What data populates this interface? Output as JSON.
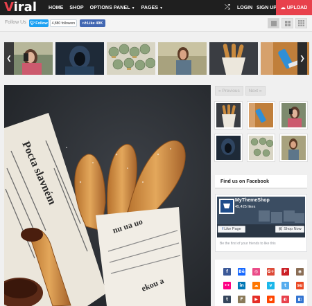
{
  "header": {
    "logo_first": "V",
    "logo_rest": "iral",
    "nav": [
      {
        "label": "HOME",
        "has_caret": false
      },
      {
        "label": "SHOP",
        "has_caret": false
      },
      {
        "label": "OPTIONS PANEL",
        "has_caret": true
      },
      {
        "label": "PAGES",
        "has_caret": true
      }
    ],
    "shuffle_icon": "shuffle-icon",
    "login_label": "LOGIN",
    "signup_label": "SIGN UP",
    "upload_label": "UPLOAD",
    "upload_icon": "cloud-upload-icon",
    "accent_color": "#e8414c",
    "bar_color": "#1f1f1f"
  },
  "social_bar": {
    "follow_label": "Follow Us",
    "twitter_button": "Follow",
    "twitter_followers": "4,880 followers",
    "facebook_like": "Like 49K",
    "layout_icons": [
      "grid-1-icon",
      "grid-2-icon",
      "grid-3-icon"
    ]
  },
  "carousel": {
    "thumbs": [
      "girl-with-phone",
      "hooded-figure",
      "rolled-banknotes",
      "woman-on-phone",
      "churros-in-paper",
      "blue-spray-bottle"
    ],
    "prev_icon": "chevron-left-icon",
    "next_icon": "chevron-right-icon"
  },
  "hero": {
    "subject": "churros-in-newspaper",
    "newspaper_text": "Pocta slavném"
  },
  "sidebar": {
    "prev_label": "« Previous",
    "next_label": "Next »",
    "related": [
      "churros",
      "blue-spray-bottle",
      "girl-with-phone",
      "hooded-figure",
      "rolled-banknotes",
      "woman-on-phone"
    ],
    "facebook_title": "Find us on Facebook",
    "fb_page_name": "MyThemeShop",
    "fb_page_likes": "45,425 likes",
    "fb_like_page": "Like Page",
    "fb_shop_now": "Shop Now",
    "fb_friends_text": "Be the first of your friends to like this",
    "social_icons": [
      {
        "name": "facebook-icon",
        "glyph": "f",
        "color": "#3b5998"
      },
      {
        "name": "behance-icon",
        "glyph": "Bē",
        "color": "#1769ff"
      },
      {
        "name": "dribbble-icon",
        "glyph": "◎",
        "color": "#ea4c89"
      },
      {
        "name": "google-plus-icon",
        "glyph": "G+",
        "color": "#dd4b39"
      },
      {
        "name": "pinterest-icon",
        "glyph": "P",
        "color": "#cb2027"
      },
      {
        "name": "instagram-icon",
        "glyph": "◉",
        "color": "#8a6d55"
      },
      {
        "name": "flickr-icon",
        "glyph": "••",
        "color": "#ff0084"
      },
      {
        "name": "linkedin-icon",
        "glyph": "in",
        "color": "#0077b5"
      },
      {
        "name": "soundcloud-icon",
        "glyph": "☁",
        "color": "#ff7700"
      },
      {
        "name": "vimeo-icon",
        "glyph": "v",
        "color": "#1ab7ea"
      },
      {
        "name": "twitter-icon",
        "glyph": "t",
        "color": "#55acee"
      },
      {
        "name": "stumbleupon-icon",
        "glyph": "su",
        "color": "#eb4924"
      },
      {
        "name": "tumblr-icon",
        "glyph": "t",
        "color": "#35465c"
      },
      {
        "name": "foursquare-icon",
        "glyph": "F",
        "color": "#8a7a5a"
      },
      {
        "name": "youtube-icon",
        "glyph": "▶",
        "color": "#e52d27"
      },
      {
        "name": "reddit-icon",
        "glyph": "◕",
        "color": "#ff4500"
      },
      {
        "name": "github-icon",
        "glyph": "◐",
        "color": "#e8414c"
      },
      {
        "name": "delicious-icon",
        "glyph": "◧",
        "color": "#3274d1"
      }
    ]
  }
}
